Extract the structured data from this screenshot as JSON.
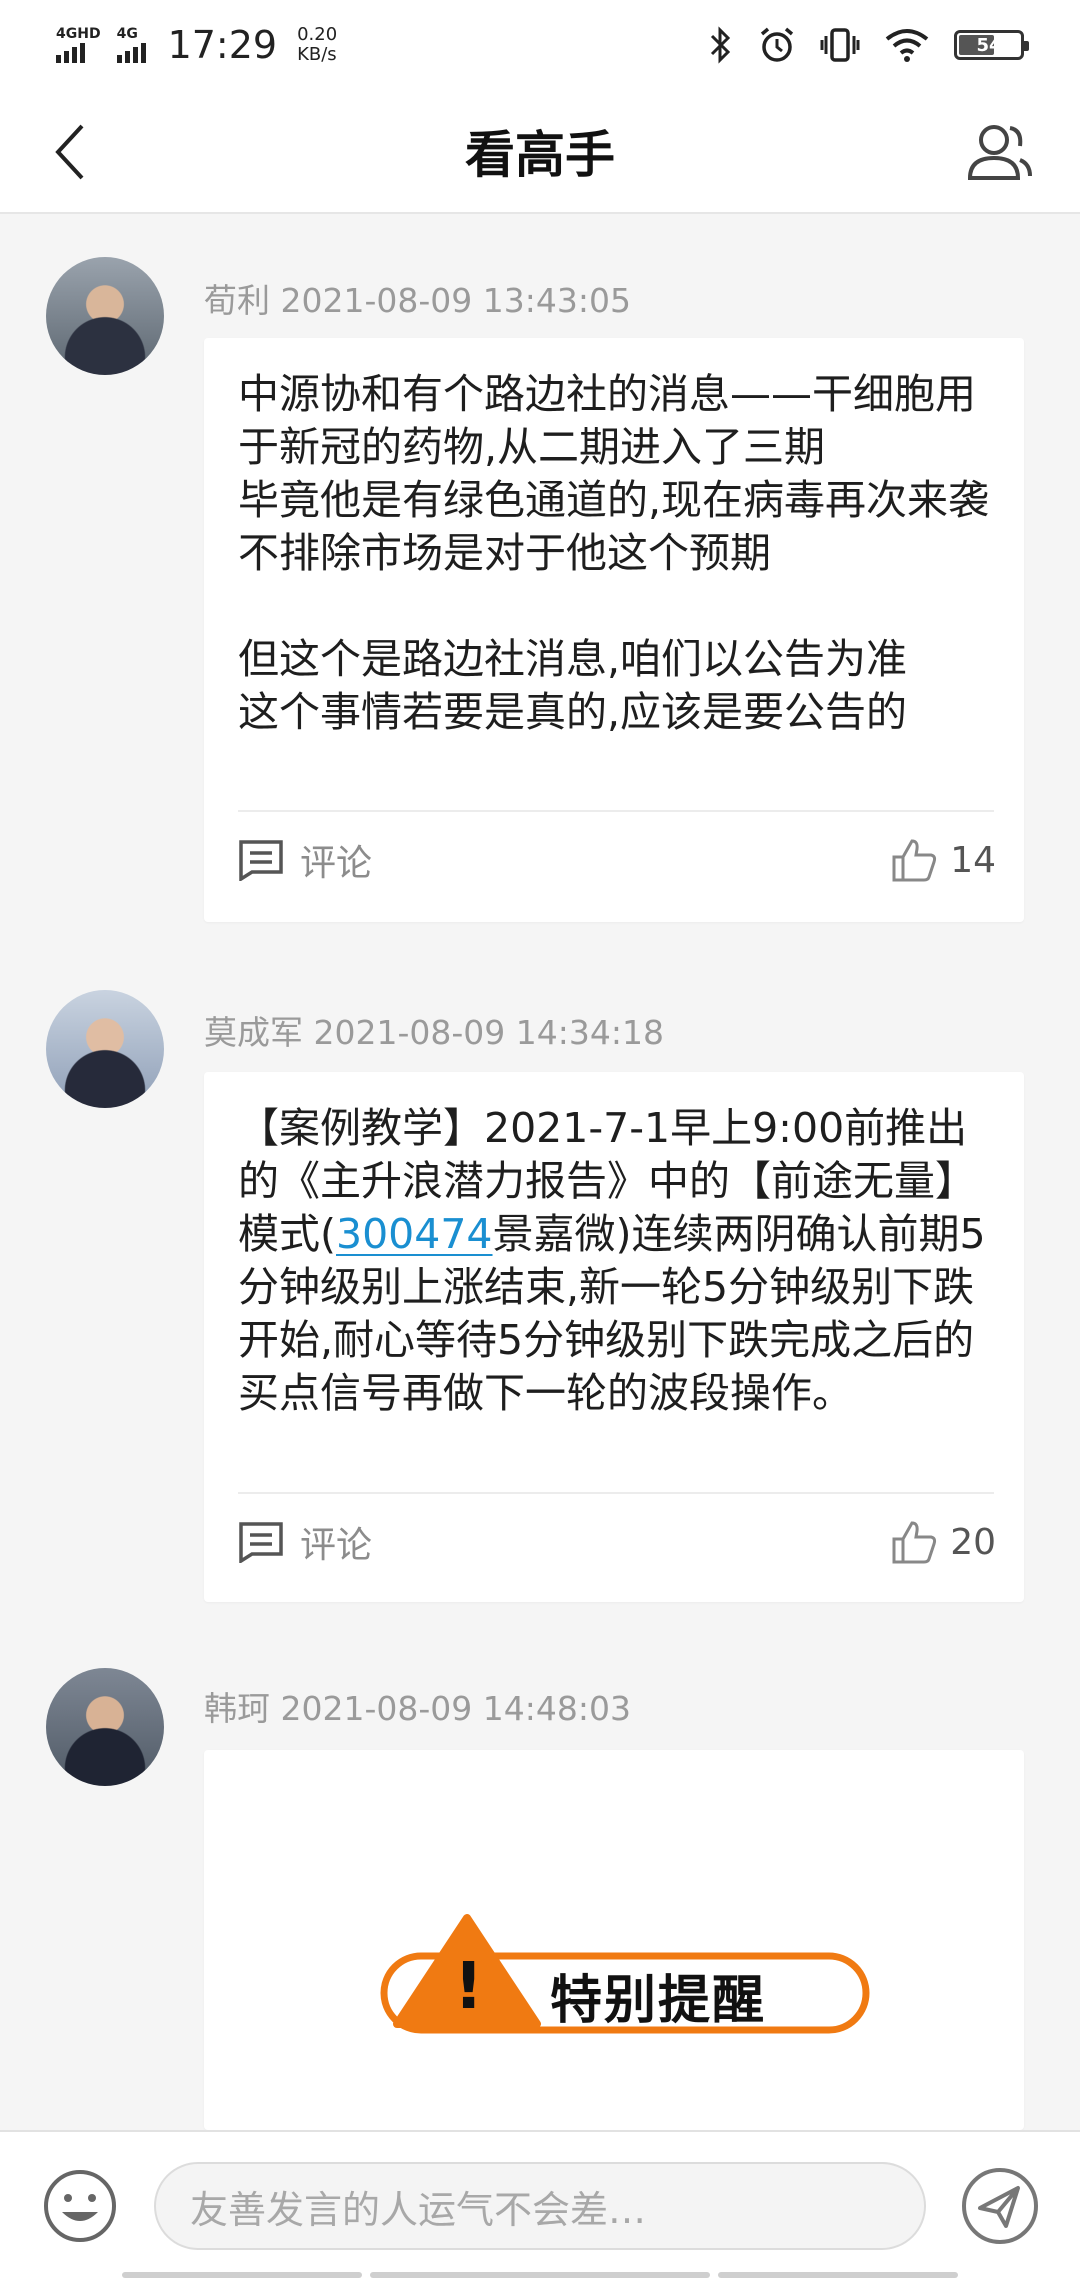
{
  "status_bar": {
    "network_1": "4GHD",
    "network_2": "4G",
    "time": "17:29",
    "speed_value": "0.20",
    "speed_unit": "KB/s",
    "battery": "54",
    "battery_fraction": 0.54
  },
  "header": {
    "title": "看高手",
    "back_icon": "chevron-left-icon",
    "right_icon": "users-icon"
  },
  "posts": [
    {
      "author": "荀利",
      "time": "2021-08-09 13:43:05",
      "content": "中源协和有个路边社的消息——干细胞用于新冠的药物,从二期进入了三期\n毕竟他是有绿色通道的,现在病毒再次来袭\n不排除市场是对于他这个预期\n\n但这个是路边社消息,咱们以公告为准\n这个事情若要是真的,应该是要公告的",
      "comment_label": "评论",
      "likes": "14"
    },
    {
      "author": "莫成军",
      "time": "2021-08-09 14:34:18",
      "content_before": "【案例教学】2021-7-1早上9:00前推出的《主升浪潜力报告》中的【前途无量】模式(",
      "stock_code": "300474",
      "content_after": "景嘉微)连续两阴确认前期5分钟级别上涨结束,新一轮5分钟级别下跌开始,耐心等待5分钟级别下跌完成之后的买点信号再做下一轮的波段操作。",
      "comment_label": "评论",
      "likes": "20"
    },
    {
      "author": "韩珂",
      "time": "2021-08-09 14:48:03",
      "banner_text": "特别提醒"
    }
  ],
  "input_bar": {
    "placeholder": "友善发言的人运气不会差…",
    "emoji_icon": "emoji-icon",
    "send_icon": "send-icon"
  },
  "colors": {
    "accent_link": "#1a8fd1",
    "banner_orange": "#f07a12",
    "background": "#f5f5f5"
  }
}
